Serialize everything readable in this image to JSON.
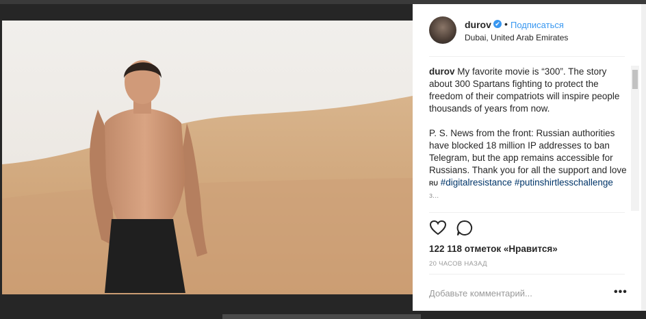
{
  "post": {
    "username": "durov",
    "verified_mark": "✔",
    "separator": "•",
    "follow_label": "Подписаться",
    "location": "Dubai, United Arab Emirates"
  },
  "caption": {
    "author": "durov",
    "text1": "My favorite movie is “300”. The story about 300 Spartans fighting to protect the freedom of their compatriots will inspire people thousands of years from now.",
    "text2": "P. S. News from the front: Russian authorities have blocked 18 million IP addresses to ban Telegram, but the app remains accessible for Russians. Thank you for all the support and love",
    "flag": "RU",
    "hashtag1": "#digitalresistance",
    "hashtag2": "#putinshirtlesschallenge",
    "truncated_line": "з..."
  },
  "actions": {
    "like_icon": "heart-icon",
    "comment_icon": "speech-bubble-icon",
    "likes_text": "122 118 отметок «Нравится»",
    "time_text": "20 часов назад"
  },
  "comment": {
    "placeholder": "Добавьте комментарий...",
    "more_label": "•••"
  },
  "colors": {
    "accent": "#3897f0",
    "hashtag": "#003569",
    "muted": "#999999",
    "overlay": "#262626"
  }
}
